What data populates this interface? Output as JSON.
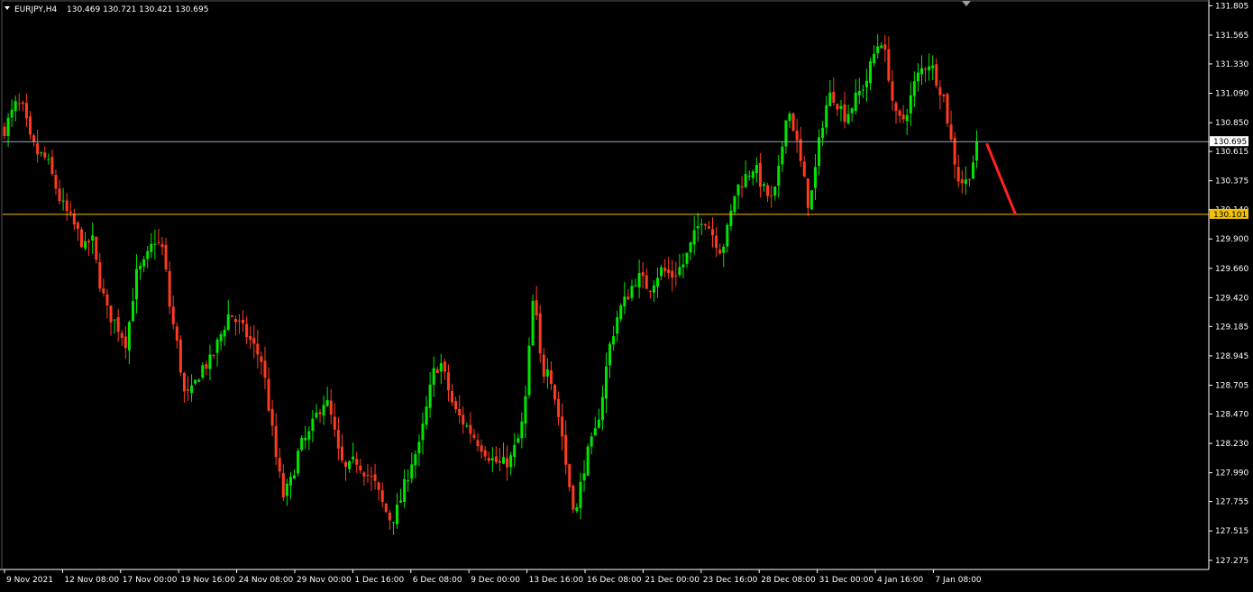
{
  "header": {
    "symbol_timeframe": "EURJPY,H4",
    "ohlc": "130.469 130.721 130.421 130.695"
  },
  "colors": {
    "background": "#000000",
    "bull": "#00e600",
    "bear": "#ff3b1f",
    "axis": "#ffffff",
    "price_line": "#a0a8b8",
    "level_line": "#f2c200",
    "level_label_bg": "#f2c200",
    "arrow": "#ff2020"
  },
  "chart_data": {
    "type": "candlestick",
    "symbol": "EURJPY",
    "timeframe": "H4",
    "y_range": [
      127.2,
      131.83
    ],
    "y_ticks": [
      "131.805",
      "131.565",
      "131.330",
      "131.090",
      "130.850",
      "130.615",
      "130.375",
      "130.140",
      "129.900",
      "129.660",
      "129.420",
      "129.185",
      "128.945",
      "128.705",
      "128.470",
      "128.230",
      "127.990",
      "127.755",
      "127.515",
      "127.275"
    ],
    "x_labels": [
      "9 Nov 2021",
      "12 Nov 08:00",
      "17 Nov 00:00",
      "19 Nov 16:00",
      "24 Nov 08:00",
      "29 Nov 00:00",
      "1 Dec 16:00",
      "6 Dec 08:00",
      "9 Dec 00:00",
      "13 Dec 16:00",
      "16 Dec 08:00",
      "21 Dec 00:00",
      "23 Dec 16:00",
      "28 Dec 08:00",
      "31 Dec 00:00",
      "4 Jan 16:00",
      "7 Jan 08:00"
    ],
    "current_price": "130.695",
    "level_price": "130.101",
    "grid": false,
    "candle_count": 266,
    "path_points": [
      [
        0,
        130.8
      ],
      [
        5,
        131.0
      ],
      [
        8,
        130.95
      ],
      [
        11,
        130.7
      ],
      [
        14,
        130.6
      ],
      [
        18,
        130.55
      ],
      [
        24,
        130.2
      ],
      [
        30,
        130.0
      ],
      [
        35,
        129.8
      ],
      [
        37,
        129.95
      ],
      [
        40,
        129.6
      ],
      [
        44,
        129.3
      ],
      [
        48,
        129.2
      ],
      [
        52,
        129.05
      ],
      [
        56,
        129.6
      ],
      [
        60,
        129.7
      ],
      [
        62,
        129.8
      ],
      [
        64,
        129.9
      ],
      [
        66,
        129.85
      ],
      [
        68,
        129.8
      ],
      [
        70,
        129.4
      ],
      [
        74,
        129.0
      ],
      [
        77,
        128.6
      ],
      [
        80,
        128.65
      ],
      [
        84,
        128.85
      ],
      [
        88,
        128.9
      ],
      [
        92,
        129.1
      ],
      [
        96,
        129.3
      ],
      [
        100,
        129.2
      ],
      [
        104,
        129.1
      ],
      [
        110,
        128.9
      ],
      [
        113,
        128.5
      ],
      [
        116,
        128.1
      ],
      [
        119,
        127.8
      ],
      [
        122,
        127.9
      ],
      [
        126,
        128.2
      ],
      [
        130,
        128.3
      ],
      [
        134,
        128.5
      ],
      [
        137,
        128.6
      ],
      [
        140,
        128.4
      ],
      [
        143,
        128.1
      ],
      [
        146,
        128.0
      ],
      [
        150,
        128.1
      ],
      [
        154,
        128.0
      ],
      [
        158,
        127.9
      ],
      [
        162,
        127.7
      ],
      [
        165,
        127.6
      ],
      [
        168,
        127.7
      ],
      [
        171,
        127.9
      ],
      [
        174,
        128.1
      ],
      [
        177,
        128.2
      ],
      [
        180,
        128.5
      ],
      [
        183,
        128.8
      ],
      [
        186,
        128.9
      ],
      [
        189,
        128.7
      ],
      [
        192,
        128.5
      ],
      [
        196,
        128.4
      ],
      [
        200,
        128.3
      ],
      [
        204,
        128.2
      ],
      [
        208,
        128.1
      ],
      [
        212,
        128.05
      ],
      [
        216,
        128.1
      ],
      [
        220,
        128.3
      ],
      [
        222,
        128.5
      ],
      [
        224,
        129.0
      ],
      [
        226,
        129.5
      ],
      [
        228,
        129.0
      ],
      [
        230,
        128.8
      ],
      [
        232,
        128.9
      ],
      [
        234,
        128.7
      ],
      [
        236,
        128.5
      ],
      [
        238,
        128.3
      ],
      [
        240,
        128.0
      ],
      [
        242,
        127.8
      ],
      [
        244,
        127.65
      ],
      [
        246,
        127.9
      ],
      [
        248,
        128.1
      ],
      [
        252,
        128.3
      ],
      [
        255,
        128.6
      ],
      [
        258,
        129.0
      ],
      [
        262,
        129.3
      ],
      [
        265,
        129.4
      ],
      [
        270,
        129.6
      ],
      [
        275,
        129.5
      ],
      [
        280,
        129.65
      ],
      [
        285,
        129.6
      ],
      [
        290,
        129.7
      ],
      [
        294,
        129.9
      ],
      [
        298,
        130.1
      ],
      [
        302,
        129.95
      ],
      [
        306,
        129.8
      ],
      [
        309,
        130.0
      ],
      [
        312,
        130.3
      ],
      [
        316,
        130.4
      ],
      [
        320,
        130.5
      ],
      [
        324,
        130.3
      ],
      [
        328,
        130.2
      ],
      [
        331,
        130.5
      ],
      [
        334,
        131.0
      ],
      [
        337,
        130.8
      ],
      [
        339,
        130.6
      ],
      [
        341,
        130.4
      ],
      [
        343,
        130.2
      ],
      [
        345,
        130.3
      ],
      [
        347,
        130.6
      ],
      [
        350,
        130.95
      ],
      [
        353,
        131.1
      ],
      [
        356,
        131.0
      ],
      [
        359,
        130.9
      ],
      [
        362,
        131.0
      ],
      [
        365,
        131.1
      ],
      [
        368,
        131.2
      ],
      [
        371,
        131.4
      ],
      [
        374,
        131.55
      ],
      [
        377,
        131.3
      ],
      [
        380,
        130.9
      ],
      [
        383,
        130.85
      ],
      [
        386,
        131.0
      ],
      [
        389,
        131.2
      ],
      [
        392,
        131.3
      ],
      [
        395,
        131.35
      ],
      [
        398,
        131.2
      ],
      [
        401,
        131.05
      ],
      [
        404,
        130.7
      ],
      [
        407,
        130.4
      ],
      [
        410,
        130.35
      ],
      [
        413,
        130.5
      ],
      [
        415,
        130.695
      ]
    ]
  }
}
